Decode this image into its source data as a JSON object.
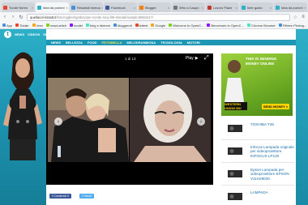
{
  "browser": {
    "tabs": [
      {
        "label": "Tunde Neres",
        "favicon": "#e8452c"
      },
      {
        "label": "Idea da pueoni",
        "favicon": "#2db0c8"
      },
      {
        "label": "Resultati ricerca",
        "favicon": "#4a90d9"
      },
      {
        "label": "Facebook",
        "favicon": "#3b5998"
      },
      {
        "label": "Blogger",
        "favicon": "#f57d00"
      },
      {
        "label": "Who a Caupo",
        "favicon": "#777777"
      },
      {
        "label": "Lavoro Piace",
        "favicon": "#c0392b"
      },
      {
        "label": "Idee gusto",
        "favicon": "#2db0c8"
      },
      {
        "label": "Idea da pueoni",
        "favicon": "#2db0c8"
      }
    ],
    "url_host": "quellacol-rissatt.it",
    "url_path": "/foto/cuglieri/gallery/per-sonite-tony-fitti-shedali-lamplin/6684417/",
    "bookmarks": [
      "App",
      "Tiziale",
      "Jeez",
      "react-articlr",
      "model",
      "blog e dintorni",
      "bloggeroti",
      "lettest",
      "Google",
      "Welcome to OpenC...",
      "Benvenuto in OpenC...",
      "Chrome Browser",
      "Fifteen Photog..."
    ]
  },
  "site": {
    "logo": "t",
    "nav": [
      "NEWS",
      "VIDEOS",
      "SPORT",
      "LIFESTYLE",
      "BLOG"
    ],
    "categories": [
      "NEWS",
      "BELLEZZA",
      "FOOD",
      "PETS/BELLA",
      "MELODRAMMONA",
      "TECNOLOGIA",
      "MOTORI"
    ],
    "active_category": "PETS/BELLA"
  },
  "gallery": {
    "counter": "1 di 13",
    "play_label": "Play"
  },
  "social": {
    "facebook": "Condividi 0",
    "twitter": "Tweet"
  },
  "ad": {
    "headline": "THIS IS SENDING MONEY ONLINE",
    "brand": "WESTERN UNION WU",
    "button": "SEND MONEY >",
    "bg_color": "#7cbc2b"
  },
  "products": [
    {
      "name": "TOSHIBA T45"
    },
    {
      "name": "Infocus Lampada originale per videoproiettore INFOCUS LP120"
    },
    {
      "name": "Epson Lampada per videoproiettore EPSON V11H29020"
    },
    {
      "name": "LAMPADA"
    }
  ]
}
